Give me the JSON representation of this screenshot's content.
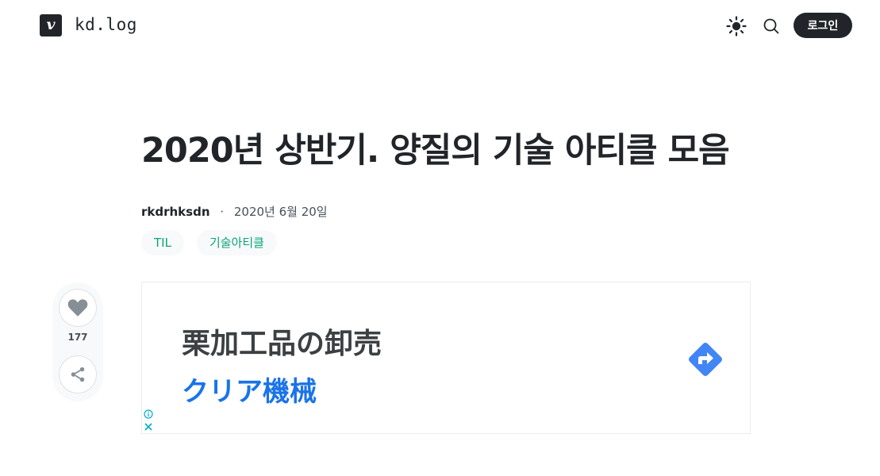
{
  "header": {
    "logo_letter": "v",
    "blog_name": "kd.log",
    "login_label": "로그인",
    "icons": [
      "sun-icon",
      "search-icon"
    ]
  },
  "post": {
    "title": "2020년 상반기. 양질의 기술 아티클 모음",
    "author": "rkdrhksdn",
    "separator": "·",
    "date": "2020년 6월 20일",
    "tags": [
      "TIL",
      "기술아티클"
    ]
  },
  "side_actions": {
    "like_count": "177",
    "icons": [
      "heart-icon",
      "share-icon"
    ]
  },
  "ad": {
    "line1": "栗加工品の卸売",
    "line2": "クリア機械",
    "icons": [
      "directions-arrow-icon",
      "ad-info-icon",
      "ad-close-icon"
    ],
    "colors": {
      "headline": "#3c4043",
      "brand": "#1a73e8",
      "arrow": "#4285f4"
    }
  },
  "colors": {
    "text": "#212529",
    "tag_text": "#0ca678",
    "tag_bg": "#f8f9fa",
    "button_bg": "#212529"
  }
}
